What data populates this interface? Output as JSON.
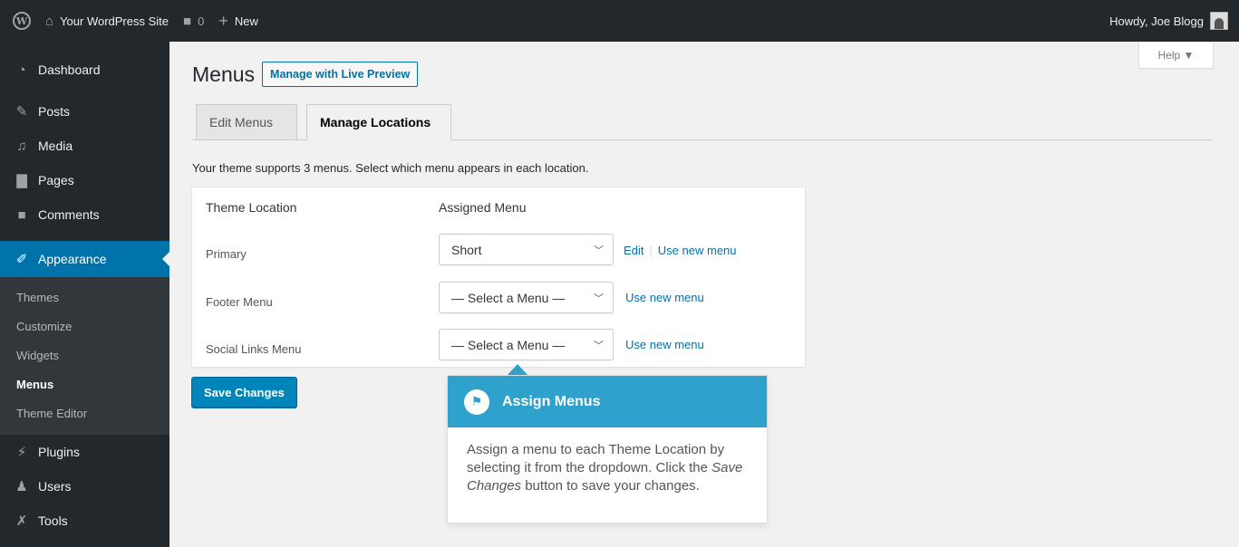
{
  "adminbar": {
    "site_name": "Your WordPress Site",
    "comments_count": "0",
    "new_label": "New",
    "howdy": "Howdy, Joe Blogg"
  },
  "sidebar": {
    "items": [
      {
        "label": "Dashboard",
        "icon": "dashboard-icon"
      },
      {
        "label": "Posts",
        "icon": "pin-icon"
      },
      {
        "label": "Media",
        "icon": "media-icon"
      },
      {
        "label": "Pages",
        "icon": "page-icon"
      },
      {
        "label": "Comments",
        "icon": "comment-icon"
      },
      {
        "label": "Appearance",
        "icon": "paintbrush-icon"
      },
      {
        "label": "Plugins",
        "icon": "plug-icon"
      },
      {
        "label": "Users",
        "icon": "users-icon"
      },
      {
        "label": "Tools",
        "icon": "wrench-icon"
      }
    ],
    "submenu": [
      "Themes",
      "Customize",
      "Widgets",
      "Menus",
      "Theme Editor"
    ]
  },
  "help": {
    "label": "Help ▼"
  },
  "page": {
    "title": "Menus",
    "live_preview_label": "Manage with Live Preview",
    "tabs": [
      "Edit Menus",
      "Manage Locations"
    ],
    "intro": "Your theme supports 3 menus. Select which menu appears in each location.",
    "table": {
      "headers": [
        "Theme Location",
        "Assigned Menu"
      ],
      "rows": [
        {
          "location": "Primary",
          "menu": "Short",
          "edit": "Edit",
          "use_new": "Use new menu"
        },
        {
          "location": "Footer Menu",
          "menu": "— Select a Menu —",
          "use_new": "Use new menu"
        },
        {
          "location": "Social Links Menu",
          "menu": "— Select a Menu —",
          "use_new": "Use new menu"
        }
      ]
    },
    "save_label": "Save Changes"
  },
  "pointer": {
    "title": "Assign Menus",
    "body_part1": "Assign a menu to each Theme Location by selecting it from the dropdown. Click the ",
    "body_em": "Save Changes",
    "body_part2": " button to save your changes."
  },
  "colors": {
    "adminbar": "#23282d",
    "accent": "#0073aa",
    "pointer": "#2ea2cc",
    "primary_button": "#0085ba"
  }
}
